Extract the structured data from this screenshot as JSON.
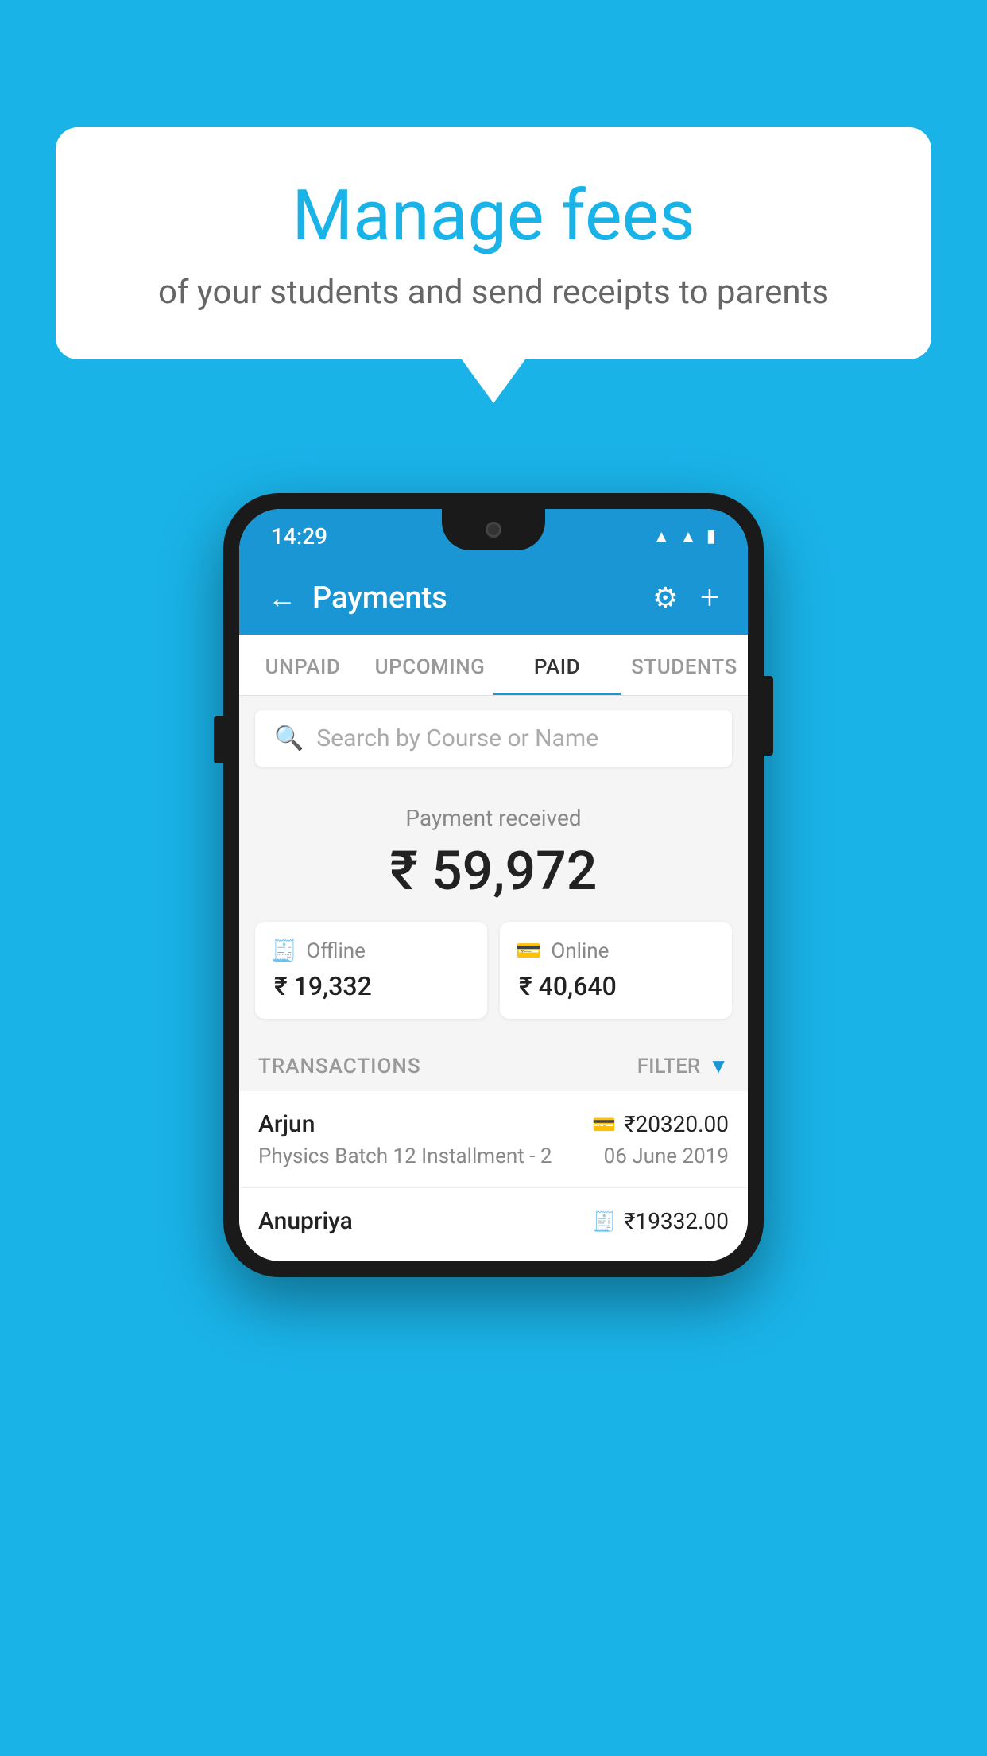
{
  "background_color": "#1ab3e8",
  "speech_bubble": {
    "title": "Manage fees",
    "subtitle": "of your students and send receipts to parents"
  },
  "phone": {
    "status_bar": {
      "time": "14:29",
      "icons": [
        "wifi",
        "signal",
        "battery"
      ]
    },
    "app_bar": {
      "title": "Payments",
      "back_label": "←",
      "settings_label": "⚙",
      "add_label": "+"
    },
    "tabs": [
      {
        "label": "UNPAID",
        "active": false
      },
      {
        "label": "UPCOMING",
        "active": false
      },
      {
        "label": "PAID",
        "active": true
      },
      {
        "label": "STUDENTS",
        "active": false
      }
    ],
    "search": {
      "placeholder": "Search by Course or Name",
      "icon": "🔍"
    },
    "payment_summary": {
      "label": "Payment received",
      "total": "₹ 59,972",
      "offline": {
        "label": "Offline",
        "amount": "₹ 19,332"
      },
      "online": {
        "label": "Online",
        "amount": "₹ 40,640"
      }
    },
    "transactions": {
      "header_label": "TRANSACTIONS",
      "filter_label": "FILTER",
      "items": [
        {
          "name": "Arjun",
          "description": "Physics Batch 12 Installment - 2",
          "amount": "₹20320.00",
          "date": "06 June 2019",
          "icon": "card"
        },
        {
          "name": "Anupriya",
          "description": "",
          "amount": "₹19332.00",
          "date": "",
          "icon": "cash"
        }
      ]
    }
  }
}
